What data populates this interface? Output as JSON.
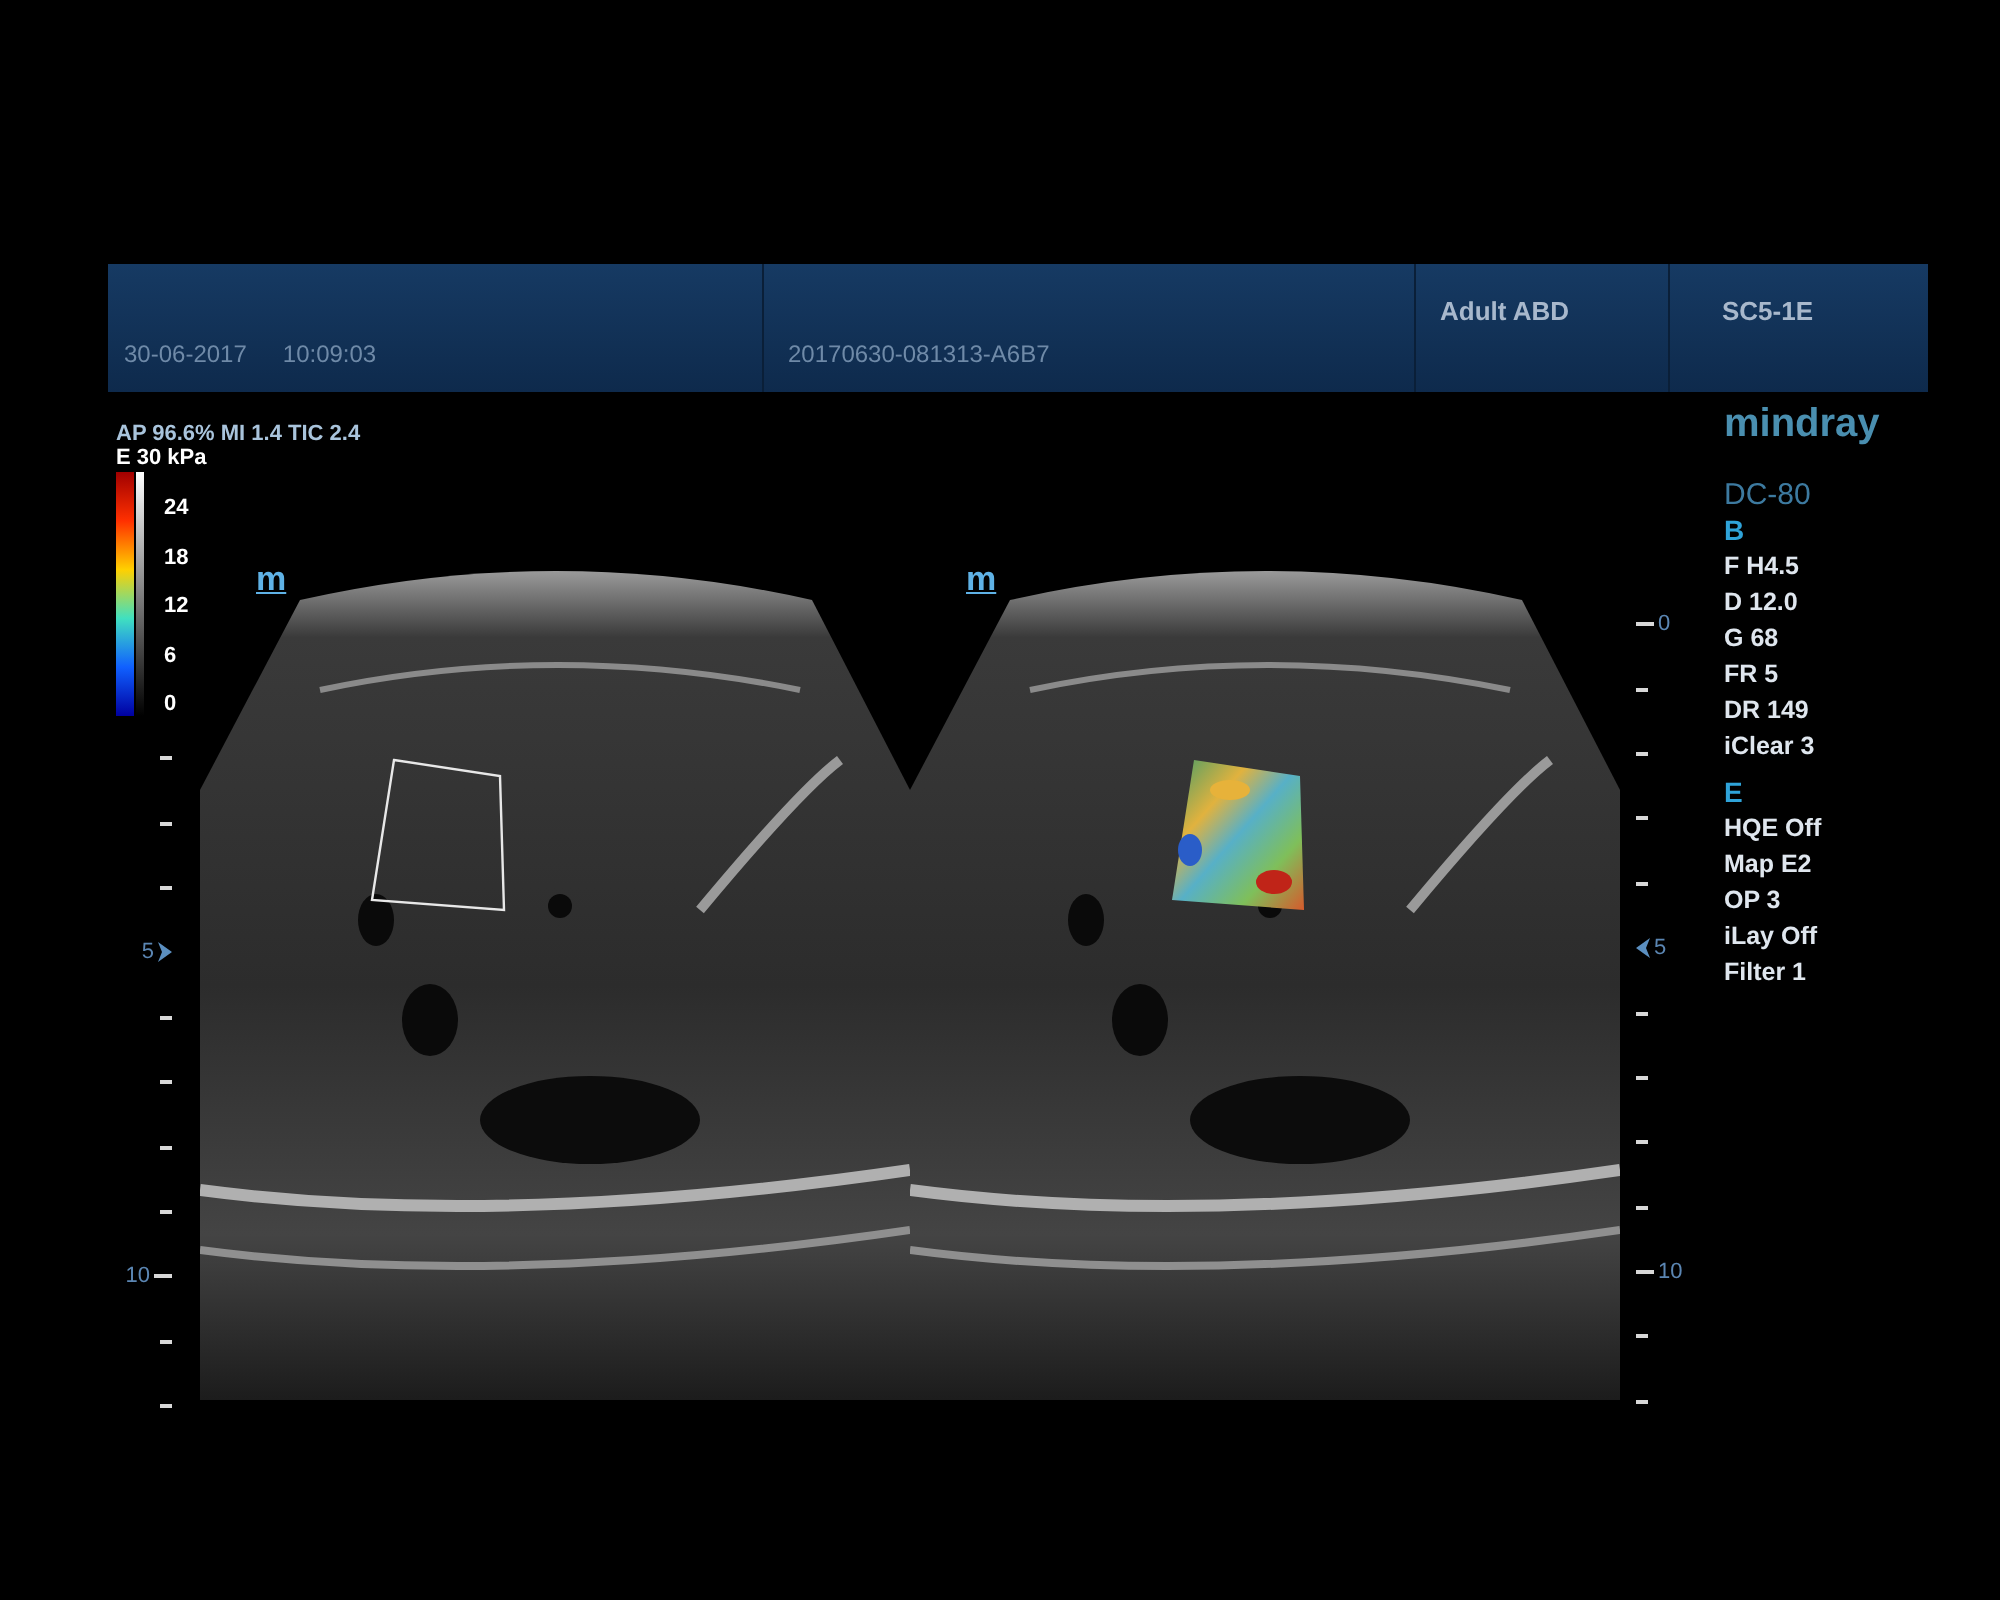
{
  "header": {
    "date": "30-06-2017",
    "time": "10:09:03",
    "exam_id": "20170630-081313-A6B7",
    "preset": "Adult ABD",
    "probe": "SC5-1E"
  },
  "acoustic_output": "AP 96.6% MI 1.4 TIC 2.4",
  "color_scale": {
    "title": "E 30 kPa",
    "labels": [
      "24",
      "18",
      "12",
      "6",
      "0"
    ]
  },
  "depth_scale_left": {
    "top_hidden": true,
    "labels": [
      {
        "text": "5",
        "focus": true
      },
      {
        "text": "10",
        "focus": false
      }
    ]
  },
  "images": [
    {
      "marker": "m",
      "kind": "outline"
    },
    {
      "marker": "m",
      "kind": "elasticity"
    }
  ],
  "depth_scale_right": {
    "top_hidden": false,
    "labels": [
      {
        "text": "0",
        "focus": false
      },
      {
        "text": "5",
        "focus": true
      },
      {
        "text": "10",
        "focus": false
      }
    ]
  },
  "brand": "mindray",
  "model": "DC-80",
  "modes": [
    {
      "name": "B",
      "params": [
        "F H4.5",
        "D 12.0",
        "G 68",
        "FR 5",
        "DR 149",
        "iClear 3"
      ]
    },
    {
      "name": "E",
      "params": [
        "HQE Off",
        "Map E2",
        "OP 3",
        "iLay Off",
        "Filter 1"
      ]
    }
  ]
}
